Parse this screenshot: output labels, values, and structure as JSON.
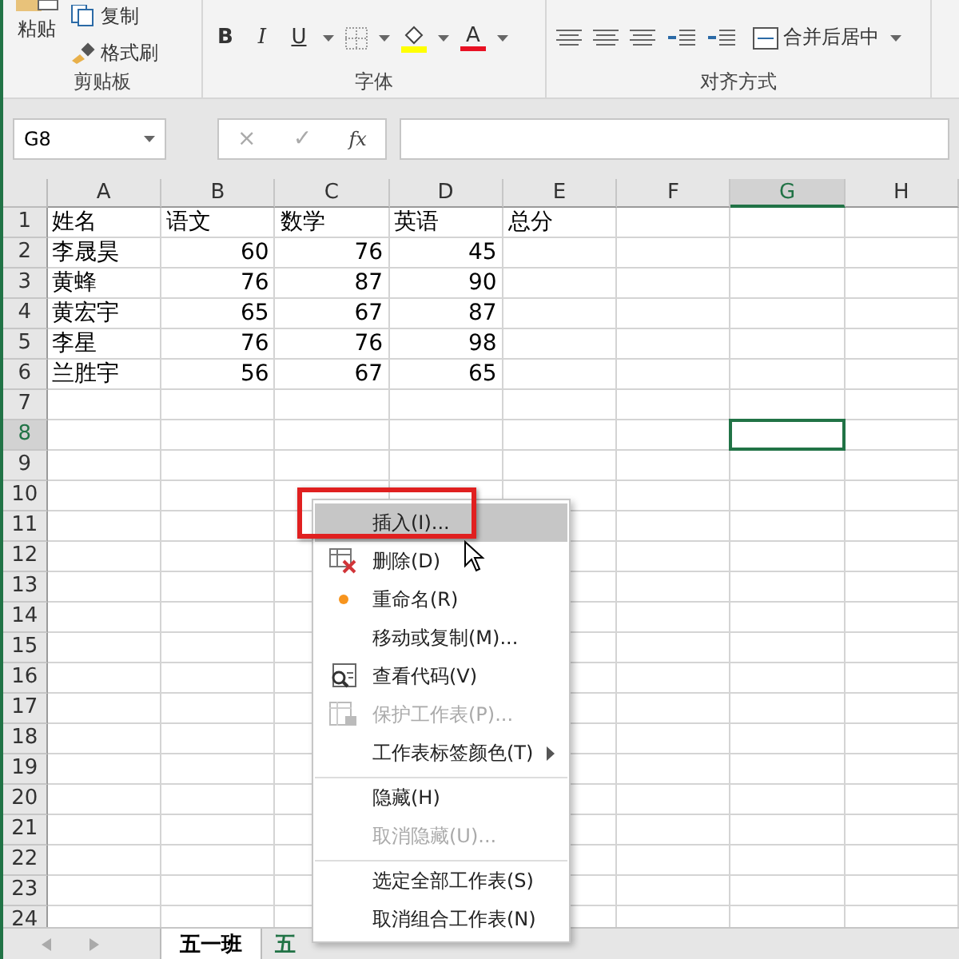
{
  "ribbon": {
    "groups": [
      {
        "label": "剪贴板",
        "buttons": [
          "粘贴",
          "复制",
          "格式刷"
        ]
      },
      {
        "label": "字体",
        "buttons": [
          "B",
          "I",
          "U",
          "A"
        ]
      },
      {
        "label": "对齐方式",
        "buttons": [
          "合并后居中"
        ]
      }
    ]
  },
  "formula_bar": {
    "name_box": "G8",
    "cancel": "×",
    "enter": "✓",
    "function": "fx"
  },
  "sheet": {
    "columns": [
      {
        "label": "A",
        "selected": false
      },
      {
        "label": "B",
        "selected": false
      },
      {
        "label": "C",
        "selected": false
      },
      {
        "label": "D",
        "selected": false
      },
      {
        "label": "E",
        "selected": false
      },
      {
        "label": "F",
        "selected": false
      },
      {
        "label": "G",
        "selected": true
      },
      {
        "label": "H",
        "selected": false
      }
    ],
    "rows": [
      {
        "label": "1",
        "selected": false,
        "cells": [
          "姓名",
          "语文",
          "数学",
          "英语",
          "总分"
        ]
      },
      {
        "label": "2",
        "selected": false,
        "cells": [
          "李晟昊",
          "60",
          "76",
          "45"
        ]
      },
      {
        "label": "3",
        "selected": false,
        "cells": [
          "黄蜂",
          "76",
          "87",
          "90"
        ]
      },
      {
        "label": "4",
        "selected": false,
        "cells": [
          "黄宏宇",
          "65",
          "67",
          "87"
        ]
      },
      {
        "label": "5",
        "selected": false,
        "cells": [
          "李星",
          "76",
          "76",
          "98"
        ]
      },
      {
        "label": "6",
        "selected": false,
        "cells": [
          "兰胜宇",
          "56",
          "67",
          "65"
        ]
      },
      {
        "label": "7",
        "selected": false,
        "cells": []
      },
      {
        "label": "8",
        "selected": true,
        "cells": []
      },
      {
        "label": "9",
        "selected": false,
        "cells": []
      },
      {
        "label": "10",
        "selected": false,
        "cells": []
      },
      {
        "label": "11",
        "selected": false,
        "cells": []
      },
      {
        "label": "12",
        "selected": false,
        "cells": []
      },
      {
        "label": "13",
        "selected": false,
        "cells": []
      },
      {
        "label": "14",
        "selected": false,
        "cells": []
      },
      {
        "label": "15",
        "selected": false,
        "cells": []
      },
      {
        "label": "16",
        "selected": false,
        "cells": []
      },
      {
        "label": "17",
        "selected": false,
        "cells": []
      },
      {
        "label": "18",
        "selected": false,
        "cells": []
      },
      {
        "label": "19",
        "selected": false,
        "cells": []
      },
      {
        "label": "20",
        "selected": false,
        "cells": []
      },
      {
        "label": "21",
        "selected": false,
        "cells": []
      },
      {
        "label": "22",
        "selected": false,
        "cells": []
      },
      {
        "label": "23",
        "selected": false,
        "cells": []
      },
      {
        "label": "24",
        "selected": false,
        "cells": []
      }
    ]
  },
  "sheet_tabs": [
    {
      "label": "五一班",
      "selected": true
    },
    {
      "label": "五",
      "selected": false
    }
  ],
  "context_menu": [
    {
      "label": "插入(I)...",
      "selected": true,
      "disabled": false,
      "separator_before": false,
      "submenu": false
    },
    {
      "label": "删除(D)",
      "selected": false,
      "disabled": false,
      "separator_before": false,
      "submenu": false
    },
    {
      "label": "重命名(R)",
      "selected": false,
      "disabled": false,
      "separator_before": false,
      "submenu": false
    },
    {
      "label": "移动或复制(M)...",
      "selected": false,
      "disabled": false,
      "separator_before": false,
      "submenu": false
    },
    {
      "label": "查看代码(V)",
      "selected": false,
      "disabled": false,
      "separator_before": false,
      "submenu": false
    },
    {
      "label": "保护工作表(P)...",
      "selected": false,
      "disabled": true,
      "separator_before": false,
      "submenu": false
    },
    {
      "label": "工作表标签颜色(T)",
      "selected": false,
      "disabled": false,
      "separator_before": false,
      "submenu": true
    },
    {
      "label": "隐藏(H)",
      "selected": false,
      "disabled": false,
      "separator_before": true,
      "submenu": false
    },
    {
      "label": "取消隐藏(U)...",
      "selected": false,
      "disabled": true,
      "separator_before": false,
      "submenu": false
    },
    {
      "label": "选定全部工作表(S)",
      "selected": false,
      "disabled": false,
      "separator_before": true,
      "submenu": false
    },
    {
      "label": "取消组合工作表(N)",
      "selected": false,
      "disabled": false,
      "separator_before": false,
      "submenu": false
    }
  ]
}
